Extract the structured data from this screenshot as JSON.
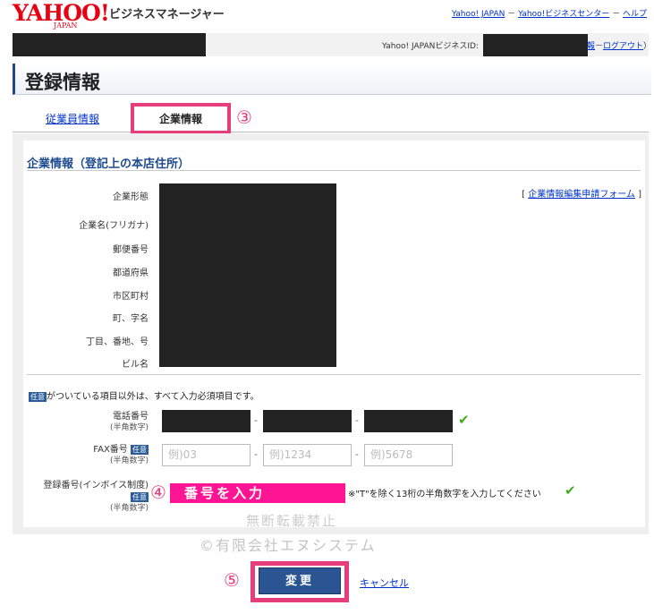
{
  "header": {
    "logo": "YAHOO!",
    "logo_sub": "JAPAN",
    "brand_title": "ビジネスマネージャー",
    "links": [
      "Yahoo! JAPAN",
      "Yahoo!ビジネスセンター",
      "ヘルプ"
    ],
    "sep": "－"
  },
  "infobar": {
    "id_label": "Yahoo! JAPANビジネスID:",
    "link_partial": "報",
    "logout": "ログアウト",
    "close_paren": "）"
  },
  "page_title": "登録情報",
  "tabs": [
    {
      "label": "従業員情報",
      "active": false
    },
    {
      "label": "企業情報",
      "active": true
    }
  ],
  "annotations": {
    "tab": "③",
    "field": "④",
    "button": "⑤"
  },
  "section": {
    "title": "企業情報（登記上の本店住所）",
    "edit_open": "[",
    "edit_link": "企業情報編集申請フォーム",
    "edit_close": "]",
    "fields": [
      "企業形態",
      "企業名(フリガナ)",
      "郵便番号",
      "都道府県",
      "市区町村",
      "町、字名",
      "丁目、番地、号",
      "ビル名"
    ]
  },
  "form": {
    "badge": "任意",
    "note": "がついている項目以外は、すべて入力必須項目です。",
    "phone": {
      "label": "電話番号",
      "sub": "(半角数字)"
    },
    "fax": {
      "label": "FAX番号",
      "sub": "(半角数字)",
      "placeholders": [
        "例)03",
        "例)1234",
        "例)5678"
      ]
    },
    "reg": {
      "label": "登録番号(インボイス制度)",
      "sub": "(半角数字)",
      "overlay": "番号を入力",
      "hint": "※\"T\"を除く13桁の半角数字を入力してください"
    },
    "dash": "-",
    "check": "✔"
  },
  "watermark": {
    "line1": "無断転載禁止",
    "line2": "©有限会社エヌシステム"
  },
  "buttons": {
    "submit": "変更",
    "cancel": "キャンセル"
  }
}
